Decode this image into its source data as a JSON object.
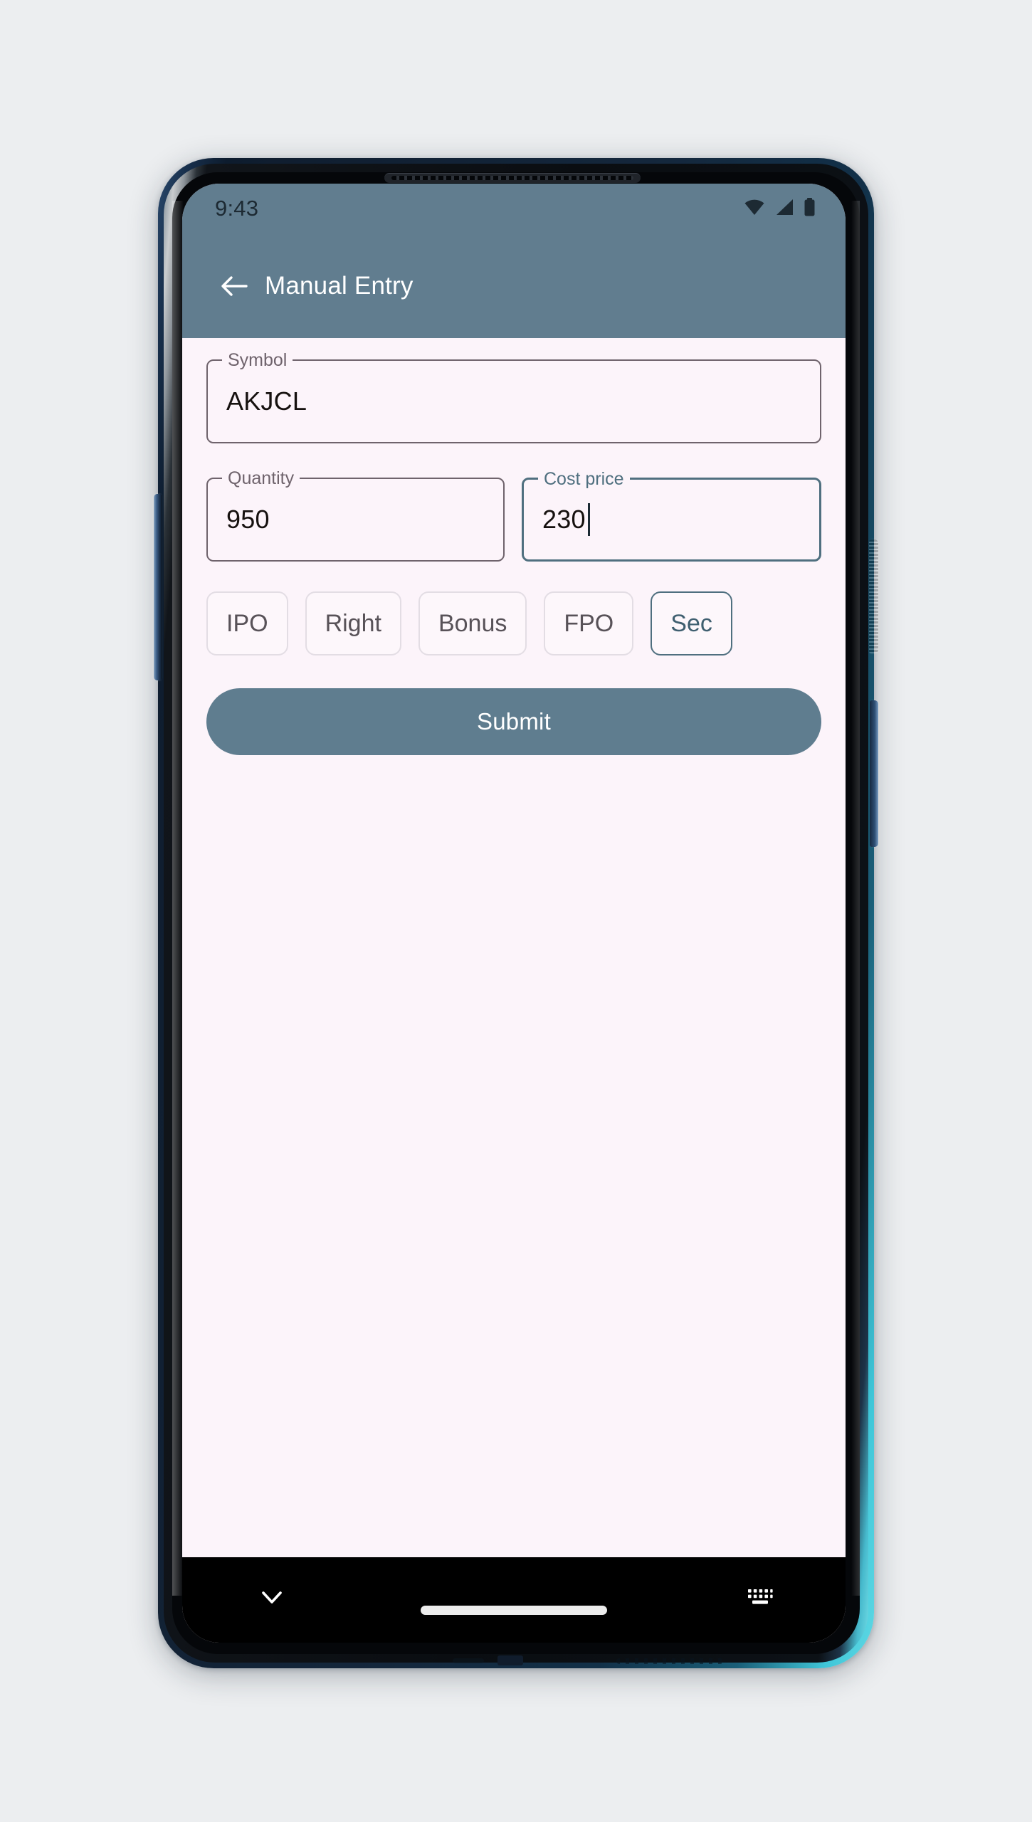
{
  "device": {
    "name": "android-smartphone",
    "frame_color": "#13263c",
    "accent_edge_color": "#5fd8e4",
    "hardware": {
      "earpiece": "earpiece-speaker",
      "volume_rocker": "volume-rocker",
      "power_button": "power-button",
      "alert_slider": "alert-slider",
      "usb_port": "usb-c-port",
      "speaker_grille": "speaker-grille",
      "microphone": "microphone"
    }
  },
  "theme": {
    "app_bar_color": "#617d8f",
    "surface_color": "#fcf4fa",
    "primary_color": "#5f7d8f",
    "outline_color": "#6f636c",
    "focus_color": "#4f6f7f",
    "on_primary_color": "#ffffff",
    "text_color": "#16110f"
  },
  "status_bar": {
    "time": "9:43",
    "icons": [
      {
        "name": "wifi-icon",
        "label": "Wi-Fi"
      },
      {
        "name": "cellular-signal-icon",
        "label": "Cellular signal"
      },
      {
        "name": "battery-icon",
        "label": "Battery"
      }
    ]
  },
  "app_bar": {
    "back_icon": "back-arrow-icon",
    "title": "Manual Entry"
  },
  "form": {
    "symbol": {
      "label": "Symbol",
      "value": "AKJCL",
      "placeholder": "",
      "focused": false
    },
    "quantity": {
      "label": "Quantity",
      "value": "950",
      "placeholder": "",
      "focused": false
    },
    "cost_price": {
      "label": "Cost price",
      "value": "230",
      "placeholder": "",
      "focused": true,
      "caret_visible": true
    },
    "chips": [
      {
        "label": "IPO",
        "selected": false
      },
      {
        "label": "Right",
        "selected": false
      },
      {
        "label": "Bonus",
        "selected": false
      },
      {
        "label": "FPO",
        "selected": false
      },
      {
        "label": "Sec",
        "selected": true
      }
    ],
    "submit_label": "Submit"
  },
  "nav_bar": {
    "dismiss_keyboard_icon": "chevron-down-icon",
    "home_indicator": "home-pill",
    "keyboard_switcher_icon": "keyboard-icon"
  }
}
